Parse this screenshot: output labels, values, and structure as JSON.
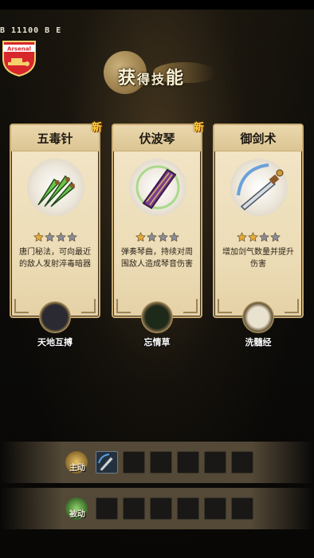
{
  "header": {
    "hud_text": "B 11100 B E",
    "club_badge_text": "Arsenal",
    "title_main": "获",
    "title_small": "得技",
    "title_end": "能"
  },
  "cards": [
    {
      "name": "五毒针",
      "is_new": true,
      "new_label": "新",
      "stars_filled": 1,
      "stars_total": 4,
      "description": "唐门秘法，可向最近的敌人发射淬毒暗器",
      "icon": "poison-needles-icon",
      "talent": {
        "label": "天地互搏",
        "icon": "talent-tiandi-icon"
      }
    },
    {
      "name": "伏波琴",
      "is_new": true,
      "new_label": "新",
      "stars_filled": 1,
      "stars_total": 4,
      "description": "弹奏琴曲，持续对周围敌人造成琴音伤害",
      "icon": "zither-icon",
      "talent": {
        "label": "忘情草",
        "icon": "talent-grass-icon"
      }
    },
    {
      "name": "御剑术",
      "is_new": false,
      "new_label": "",
      "stars_filled": 2,
      "stars_total": 4,
      "description": "增加剑气数量并提升伤害",
      "icon": "flying-sword-icon",
      "talent": {
        "label": "洗髓经",
        "icon": "talent-scripture-icon"
      }
    }
  ],
  "skill_bars": {
    "active": {
      "label": "主动",
      "slots": 6,
      "filled": 1,
      "filled_icon": "sword-skill-icon"
    },
    "passive": {
      "label": "被动",
      "slots": 6,
      "filled": 0
    }
  },
  "colors": {
    "star_filled": "#e2a93b",
    "star_empty": "#8a8c95",
    "new_badge": "#ffcf3e",
    "card_bg": "#f0e2c0"
  }
}
